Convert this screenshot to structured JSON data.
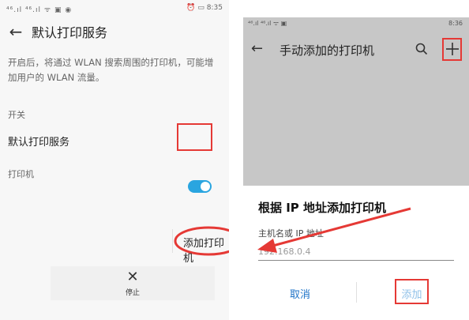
{
  "left": {
    "status": {
      "left": "⁴⁶.ıl ⁴⁶.ıl ᯤ ▣ ◉",
      "right": "⏰ ▭ 8:35"
    },
    "title": "默认打印服务",
    "description": "开启后，将通过 WLAN 搜索周围的打印机，可能增加用户的 WLAN 流量。",
    "switch_section": "开关",
    "default_service_label": "默认打印服务",
    "default_service_on": true,
    "printers_section": "打印机",
    "add_printer_label": "添加打印机",
    "stop_label": "停止"
  },
  "right": {
    "status_time": "8:36",
    "title": "手动添加的打印机",
    "dialog": {
      "title": "根据 IP 地址添加打印机",
      "field_label": "主机名或 IP 地址",
      "field_placeholder": "192.168.0.4",
      "cancel_label": "取消",
      "add_label": "添加"
    }
  },
  "colors": {
    "annotation_red": "#e53935",
    "toggle_blue": "#2aa5e0",
    "link_blue": "#1e73c8"
  }
}
